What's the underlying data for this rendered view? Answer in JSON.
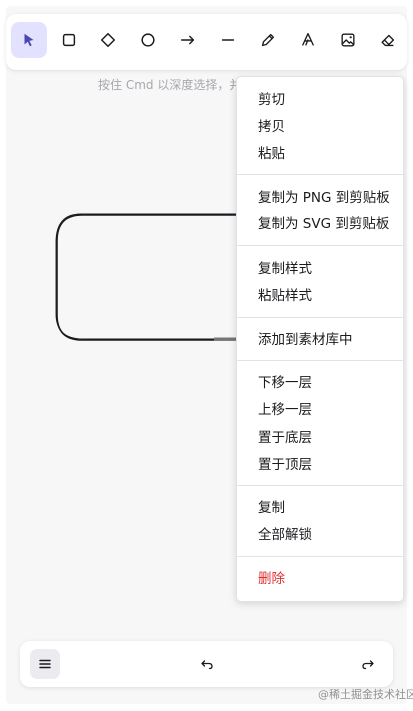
{
  "toolbar": {
    "tools": [
      {
        "icon": "selection-arrow-icon",
        "active": true
      },
      {
        "icon": "rectangle-icon"
      },
      {
        "icon": "diamond-icon"
      },
      {
        "icon": "ellipse-icon"
      },
      {
        "icon": "arrow-icon"
      },
      {
        "icon": "line-icon"
      },
      {
        "icon": "pencil-icon"
      },
      {
        "icon": "text-icon"
      },
      {
        "icon": "image-icon"
      },
      {
        "icon": "eraser-icon"
      }
    ]
  },
  "canvas": {
    "hint": "按住 Cmd 以深度选择，并"
  },
  "context_menu": {
    "cut": "剪切",
    "copy": "拷贝",
    "paste": "粘贴",
    "copy_png": "复制为 PNG 到剪贴板",
    "copy_svg": "复制为 SVG 到剪贴板",
    "copy_styles": "复制样式",
    "paste_styles": "粘贴样式",
    "add_to_library": "添加到素材库中",
    "send_backward": "下移一层",
    "bring_forward": "上移一层",
    "send_to_back": "置于底层",
    "bring_to_front": "置于顶层",
    "duplicate": "复制",
    "unlock_all": "全部解锁",
    "delete": "删除"
  },
  "footer": {
    "menu_icon": "hamburger-icon",
    "undo_icon": "undo-icon",
    "redo_icon": "redo-icon"
  },
  "watermark": "@稀土掘金技术社区",
  "colors": {
    "accent": "#4a47b1",
    "accent_bg": "#e3e2fe",
    "danger": "#e03131"
  }
}
